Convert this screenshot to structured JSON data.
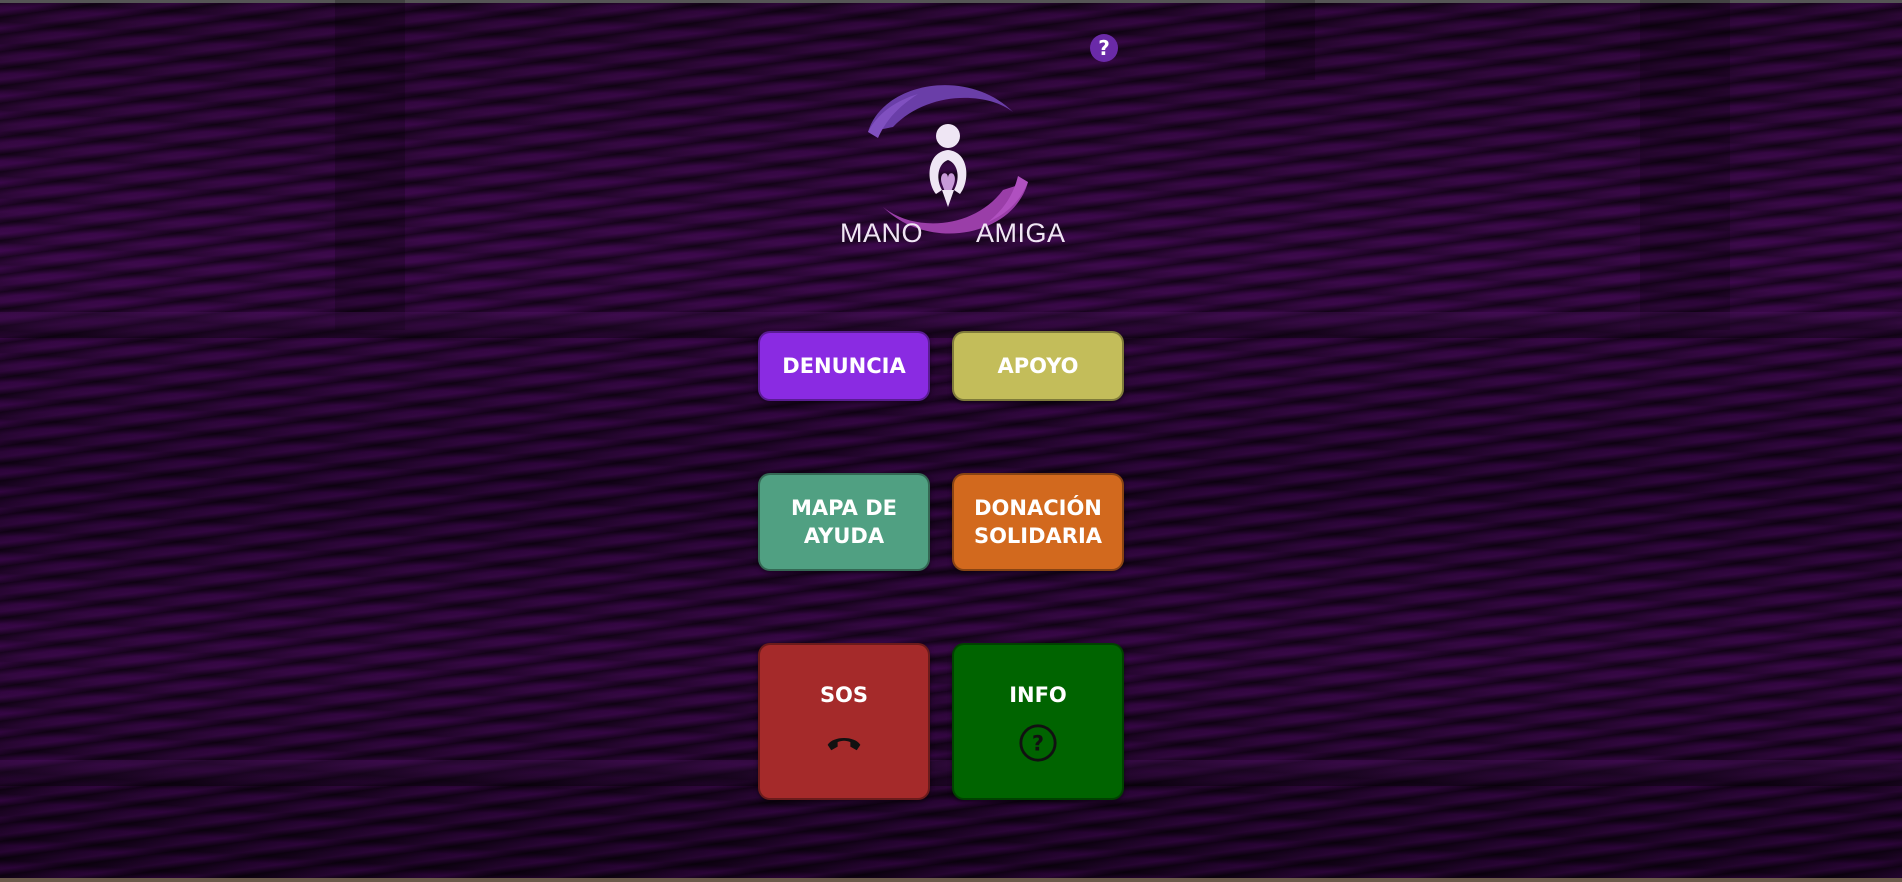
{
  "help": {
    "label": "?"
  },
  "logo": {
    "left_word": "MANO",
    "right_word": "AMIGA"
  },
  "tiles": [
    {
      "label": "DENUNCIA",
      "color": "#8a2be2"
    },
    {
      "label": "APOYO",
      "color": "#c3bd5a"
    },
    {
      "label_line1": "MAPA DE",
      "label_line2": "AYUDA",
      "color": "#50a082"
    },
    {
      "label_line1": "DONACIÓN",
      "label_line2": "SOLIDARIA",
      "color": "#d2691e"
    },
    {
      "label": "SOS",
      "icon": "phone-hangup-icon",
      "color": "#a52a2a"
    },
    {
      "label": "INFO",
      "icon": "question-circle-icon",
      "color": "#006400"
    }
  ]
}
